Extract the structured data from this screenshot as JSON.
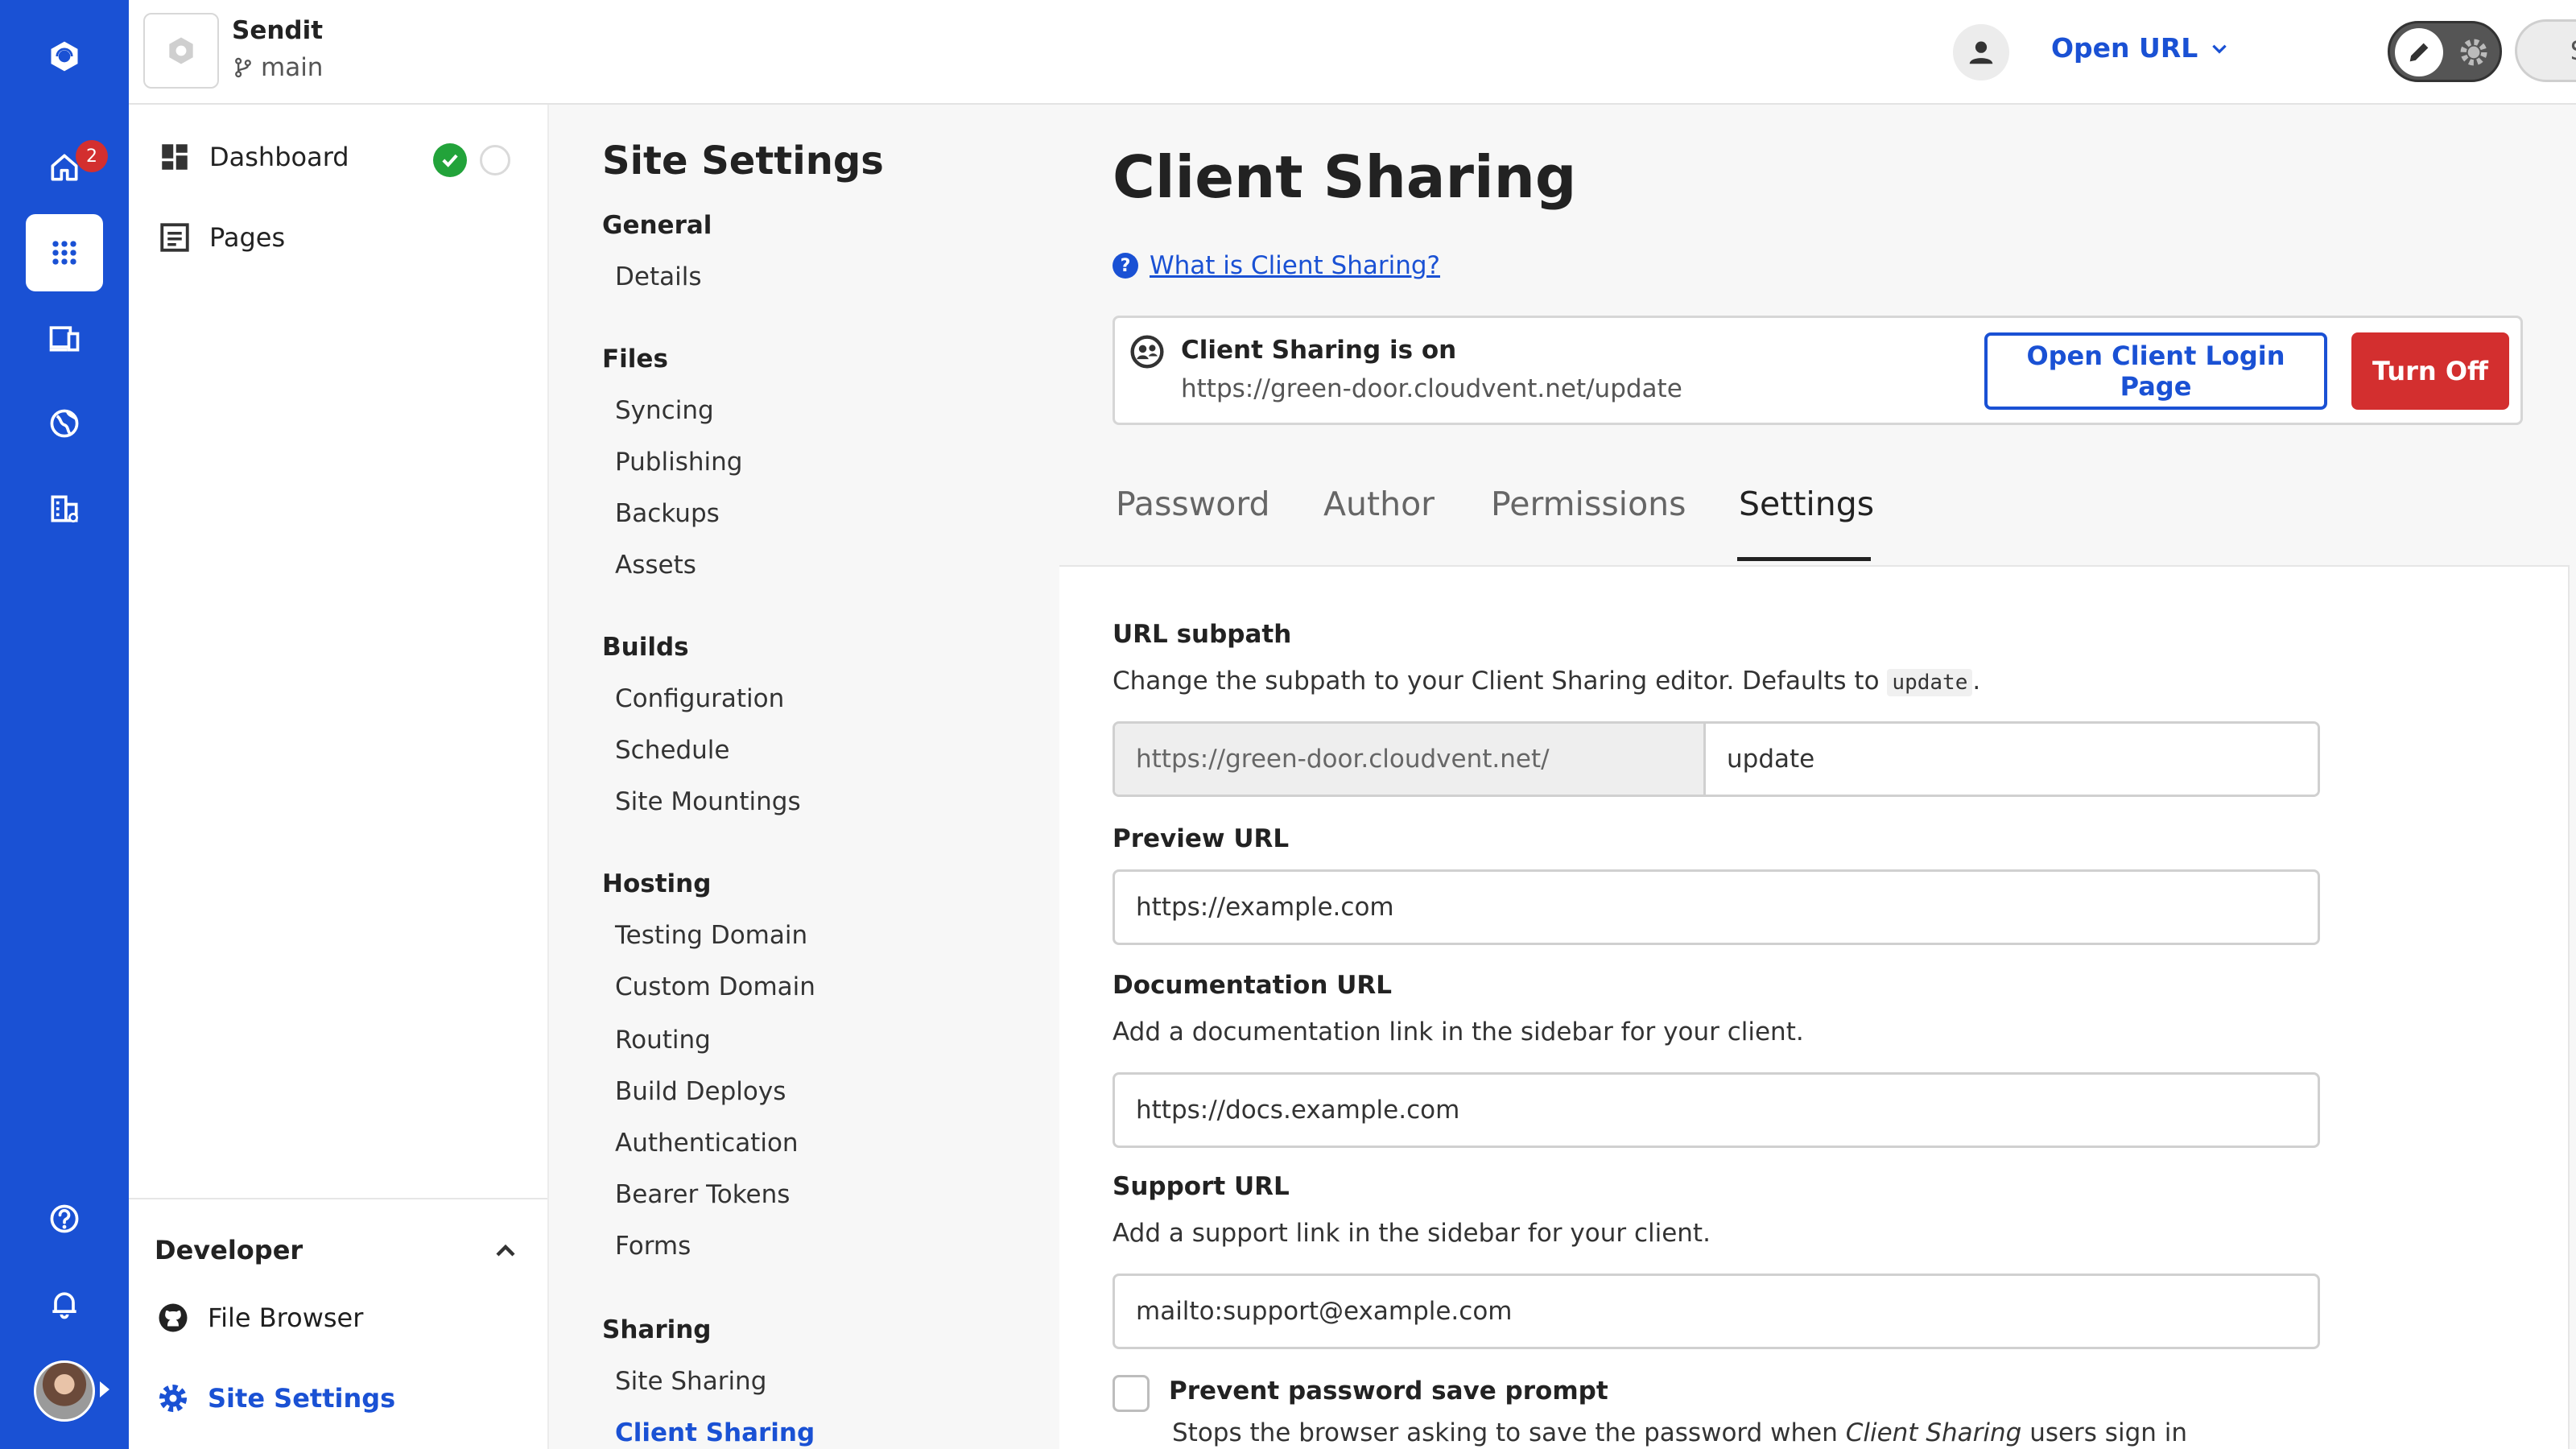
{
  "rail": {
    "home_badge": "2",
    "items": [
      "home-icon",
      "apps-grid-icon",
      "devices-icon",
      "globe-icon",
      "buildings-icon",
      "help-icon",
      "bell-icon"
    ]
  },
  "topbar": {
    "site_name": "Sendit",
    "branch": "main",
    "open_url": "Open URL",
    "save": "Save"
  },
  "nav": {
    "items": [
      {
        "label": "Dashboard",
        "icon": "dashboard-icon"
      },
      {
        "label": "Pages",
        "icon": "pages-icon"
      }
    ],
    "developer": {
      "title": "Developer",
      "items": [
        {
          "label": "File Browser",
          "icon": "github-icon"
        },
        {
          "label": "Site Settings",
          "icon": "gear-icon"
        }
      ]
    }
  },
  "menu": {
    "title": "Site Settings",
    "groups": [
      {
        "title": "General",
        "links": [
          "Details"
        ]
      },
      {
        "title": "Files",
        "links": [
          "Syncing",
          "Publishing",
          "Backups",
          "Assets"
        ]
      },
      {
        "title": "Builds",
        "links": [
          "Configuration",
          "Schedule",
          "Site Mountings"
        ]
      },
      {
        "title": "Hosting",
        "links": [
          "Testing Domain",
          "Custom Domain",
          "Routing",
          "Build Deploys",
          "Authentication",
          "Bearer Tokens",
          "Forms"
        ]
      },
      {
        "title": "Sharing",
        "links": [
          "Site Sharing",
          "Client Sharing"
        ]
      }
    ]
  },
  "main": {
    "title": "Client Sharing",
    "help_link": "What is Client Sharing?",
    "banner": {
      "title": "Client Sharing is on",
      "url": "https://green-door.cloudvent.net/update",
      "open_button": "Open Client Login Page",
      "off_button": "Turn Off"
    },
    "tabs": [
      "Password",
      "Author",
      "Permissions",
      "Settings"
    ],
    "settings": {
      "subpath_label": "URL subpath",
      "subpath_desc_before": "Change the subpath to your Client Sharing editor. Defaults to",
      "subpath_default": "update",
      "subpath_desc_after": ".",
      "subpath_prefix": "https://green-door.cloudvent.net/",
      "subpath_value": "update",
      "preview_label": "Preview URL",
      "preview_value": "https://example.com",
      "docs_label": "Documentation URL",
      "docs_desc": "Add a documentation link in the sidebar for your client.",
      "docs_value": "https://docs.example.com",
      "support_label": "Support URL",
      "support_desc": "Add a support link in the sidebar for your client.",
      "support_value": "mailto:support@example.com",
      "prevent_label": "Prevent password save prompt",
      "prevent_desc_before": "Stops the browser asking to save the password when",
      "prevent_desc_em": "Client Sharing",
      "prevent_desc_after": "users sign in"
    }
  }
}
